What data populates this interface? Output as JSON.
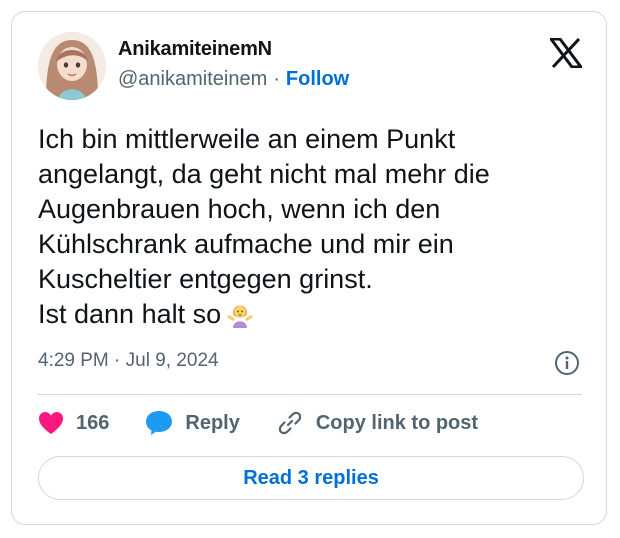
{
  "author": {
    "display_name": "AnikamiteinemN",
    "handle": "@anikamiteinem",
    "separator": "·",
    "follow_label": "Follow"
  },
  "tweet": {
    "lines": [
      "Ich bin mittlerweile an einem Punkt",
      "angelangt, da geht nicht mal mehr die",
      "Augenbrauen hoch, wenn ich den",
      "Kühlschrank aufmache und mir ein",
      "Kuscheltier entgegen grinst.",
      "Ist dann halt so"
    ],
    "emoji": "person-shrugging-emoji",
    "timestamp": "4:29 PM · Jul 9, 2024"
  },
  "actions": {
    "like_count": "166",
    "reply_label": "Reply",
    "copy_label": "Copy link to post"
  },
  "read_replies_label": "Read 3 replies",
  "icons": {
    "brand": "x-logo-icon",
    "info": "info-icon",
    "like": "heart-icon",
    "reply": "speech-bubble-icon",
    "copy": "link-icon"
  },
  "colors": {
    "link_blue": "#006fd6",
    "heart_pink": "#f91880",
    "reply_blue": "#1d9bf0",
    "secondary_text": "#536471",
    "border": "#cfd9de"
  }
}
